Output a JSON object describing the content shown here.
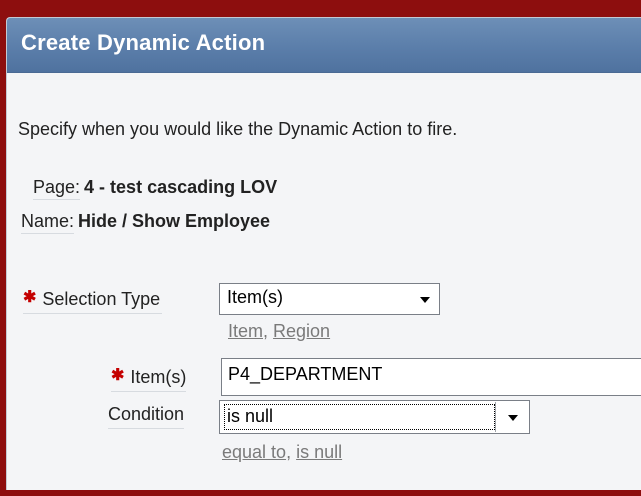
{
  "dialog": {
    "title": "Create Dynamic Action",
    "intro": "Specify when you would like the Dynamic Action to fire."
  },
  "info": {
    "page_label": "Page:",
    "page_value": "4 - test cascading LOV",
    "name_label": "Name:",
    "name_value": "Hide / Show Employee"
  },
  "form": {
    "required_marker": "✱",
    "selection_type": {
      "label": "Selection Type",
      "value": "Item(s)",
      "shortcuts": [
        "Item",
        "Region"
      ]
    },
    "items": {
      "label": "Item(s)",
      "value": "P4_DEPARTMENT"
    },
    "condition": {
      "label": "Condition",
      "value": "is null",
      "shortcuts": [
        "equal to",
        "is null"
      ]
    },
    "shortcut_separator": ", "
  },
  "colors": {
    "header": "#5b7eaa",
    "required": "#c40000",
    "background_frame": "#8d0e0e"
  }
}
